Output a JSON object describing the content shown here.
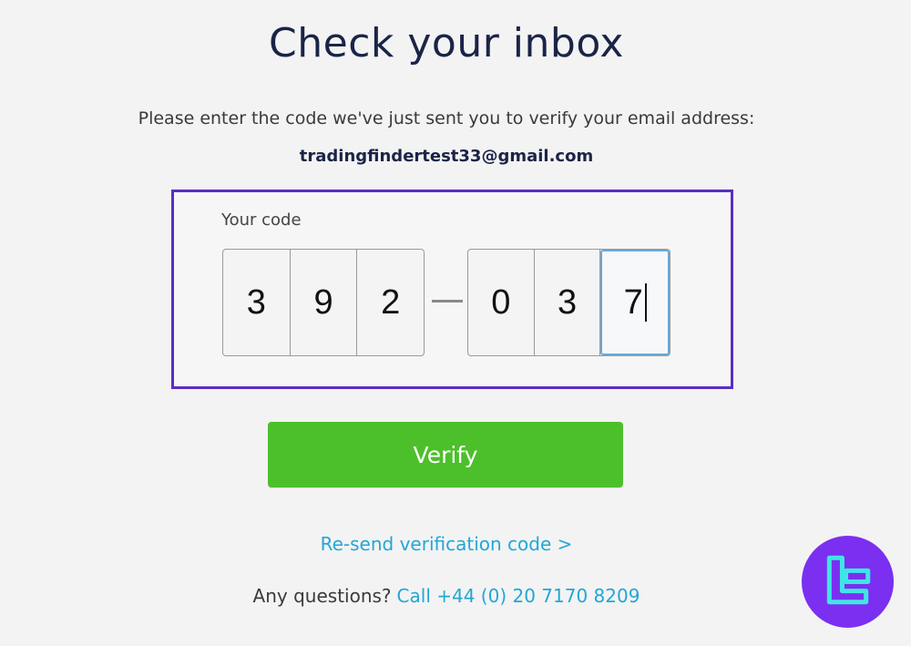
{
  "page": {
    "title": "Check your inbox",
    "instructions": "Please enter the code we've just sent you to verify your email address:",
    "email": "tradingfindertest33@gmail.com"
  },
  "code": {
    "label": "Your code",
    "group1": [
      "3",
      "9",
      "2"
    ],
    "group2": [
      "0",
      "3",
      "7"
    ]
  },
  "actions": {
    "verify_label": "Verify",
    "resend_label": "Re-send verification code >"
  },
  "contact": {
    "prompt": "Any questions?",
    "phone": "Call +44 (0) 20 7170 8209"
  },
  "colors": {
    "accent_green": "#4cc02a",
    "link_blue": "#22a7d6",
    "highlight_purple": "#5a2ec4",
    "logo_bg": "#7b2ff0",
    "logo_glyph": "#3ee6e6"
  }
}
